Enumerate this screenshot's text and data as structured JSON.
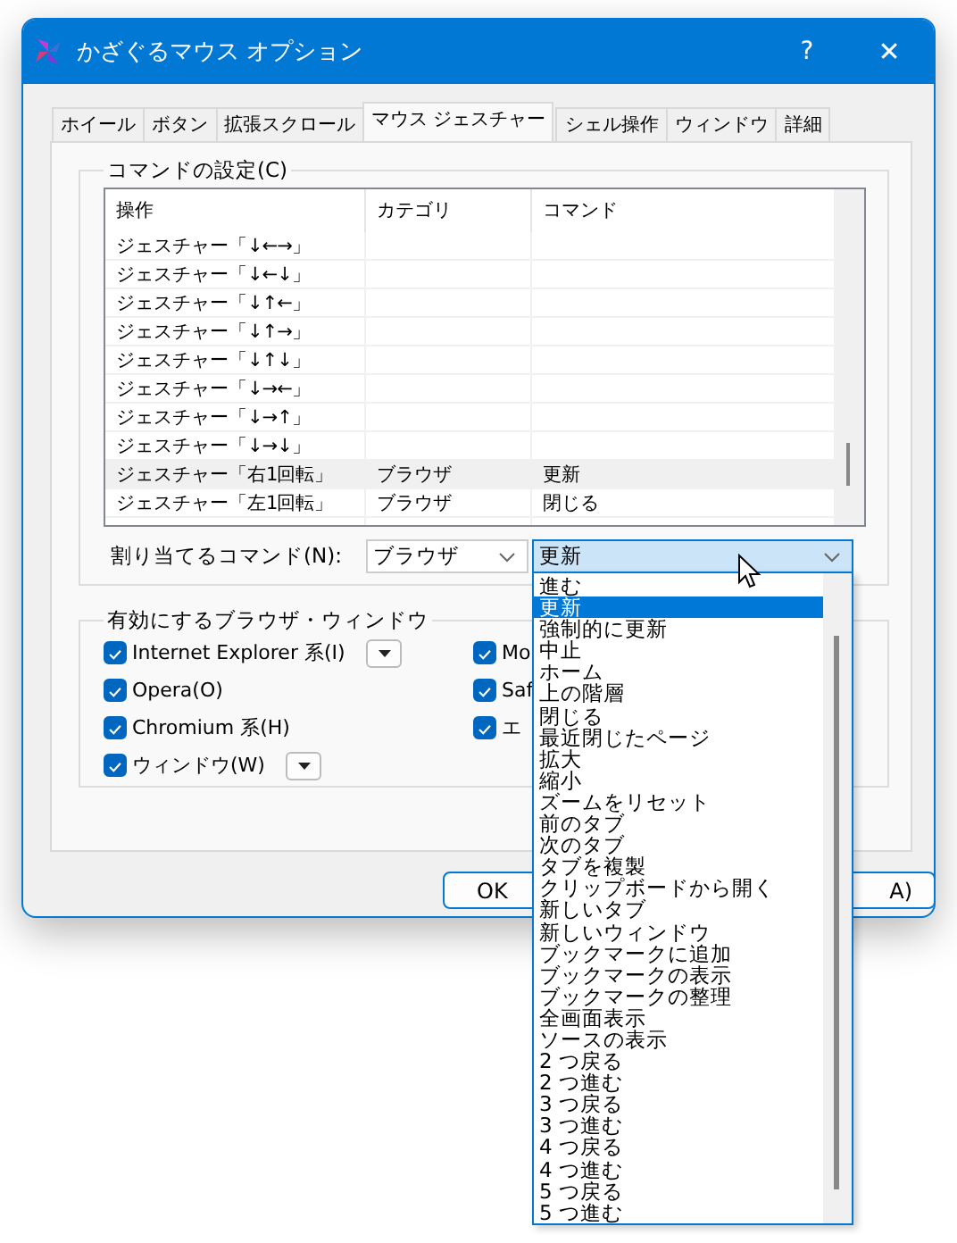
{
  "window": {
    "title": "かざぐるマウス オプション",
    "help": "?",
    "close": "✕"
  },
  "tabs": [
    {
      "label": "ホイール",
      "selected": false
    },
    {
      "label": "ボタン",
      "selected": false
    },
    {
      "label": "拡張スクロール",
      "selected": false
    },
    {
      "label": "マウス ジェスチャー",
      "selected": true
    },
    {
      "label": "シェル操作",
      "selected": false
    },
    {
      "label": "ウィンドウ",
      "selected": false
    },
    {
      "label": "詳細",
      "selected": false
    }
  ],
  "command_group": {
    "title": "コマンドの設定(C)",
    "table": {
      "columns": [
        "操作",
        "カテゴリ",
        "コマンド"
      ],
      "rows": [
        {
          "cells": [
            "ジェスチャー「↓←→」",
            "",
            ""
          ],
          "selected": false
        },
        {
          "cells": [
            "ジェスチャー「↓←↓」",
            "",
            ""
          ],
          "selected": false
        },
        {
          "cells": [
            "ジェスチャー「↓↑←」",
            "",
            ""
          ],
          "selected": false
        },
        {
          "cells": [
            "ジェスチャー「↓↑→」",
            "",
            ""
          ],
          "selected": false
        },
        {
          "cells": [
            "ジェスチャー「↓↑↓」",
            "",
            ""
          ],
          "selected": false
        },
        {
          "cells": [
            "ジェスチャー「↓→←」",
            "",
            ""
          ],
          "selected": false
        },
        {
          "cells": [
            "ジェスチャー「↓→↑」",
            "",
            ""
          ],
          "selected": false
        },
        {
          "cells": [
            "ジェスチャー「↓→↓」",
            "",
            ""
          ],
          "selected": false
        },
        {
          "cells": [
            "ジェスチャー「右1回転」",
            "ブラウザ",
            "更新"
          ],
          "selected": true
        },
        {
          "cells": [
            "ジェスチャー「左1回転」",
            "ブラウザ",
            "閉じる"
          ],
          "selected": false
        }
      ]
    },
    "assign_label": "割り当てるコマンド(N):",
    "category_value": "ブラウザ",
    "command_value": "更新"
  },
  "command_dropdown": {
    "items": [
      {
        "label": "進む",
        "selected": false
      },
      {
        "label": "更新",
        "selected": true
      },
      {
        "label": "強制的に更新",
        "selected": false
      },
      {
        "label": "中止",
        "selected": false
      },
      {
        "label": "ホーム",
        "selected": false
      },
      {
        "label": "上の階層",
        "selected": false
      },
      {
        "label": "閉じる",
        "selected": false
      },
      {
        "label": "最近閉じたページ",
        "selected": false
      },
      {
        "label": "拡大",
        "selected": false
      },
      {
        "label": "縮小",
        "selected": false
      },
      {
        "label": "ズームをリセット",
        "selected": false
      },
      {
        "label": "前のタブ",
        "selected": false
      },
      {
        "label": "次のタブ",
        "selected": false
      },
      {
        "label": "タブを複製",
        "selected": false
      },
      {
        "label": "クリップボードから開く",
        "selected": false
      },
      {
        "label": "新しいタブ",
        "selected": false
      },
      {
        "label": "新しいウィンドウ",
        "selected": false
      },
      {
        "label": "ブックマークに追加",
        "selected": false
      },
      {
        "label": "ブックマークの表示",
        "selected": false
      },
      {
        "label": "ブックマークの整理",
        "selected": false
      },
      {
        "label": "全画面表示",
        "selected": false
      },
      {
        "label": "ソースの表示",
        "selected": false
      },
      {
        "label": "2 つ戻る",
        "selected": false
      },
      {
        "label": "2 つ進む",
        "selected": false
      },
      {
        "label": "3 つ戻る",
        "selected": false
      },
      {
        "label": "3 つ進む",
        "selected": false
      },
      {
        "label": "4 つ戻る",
        "selected": false
      },
      {
        "label": "4 つ進む",
        "selected": false
      },
      {
        "label": "5 つ戻る",
        "selected": false
      },
      {
        "label": "5 つ進む",
        "selected": false
      }
    ]
  },
  "browser_group": {
    "title": "有効にするブラウザ・ウィンドウ",
    "left": [
      {
        "label": "Internet Explorer 系(I)",
        "checked": true,
        "menu": true
      },
      {
        "label": "Opera(O)",
        "checked": true,
        "menu": false
      },
      {
        "label": "Chromium 系(H)",
        "checked": true,
        "menu": false
      },
      {
        "label": "ウィンドウ(W)",
        "checked": true,
        "menu": true
      }
    ],
    "right": [
      {
        "label": "Mo",
        "checked": true
      },
      {
        "label": "Saf",
        "checked": true
      },
      {
        "label": "エ",
        "checked": true
      }
    ]
  },
  "buttons": [
    "OK",
    "A)"
  ]
}
